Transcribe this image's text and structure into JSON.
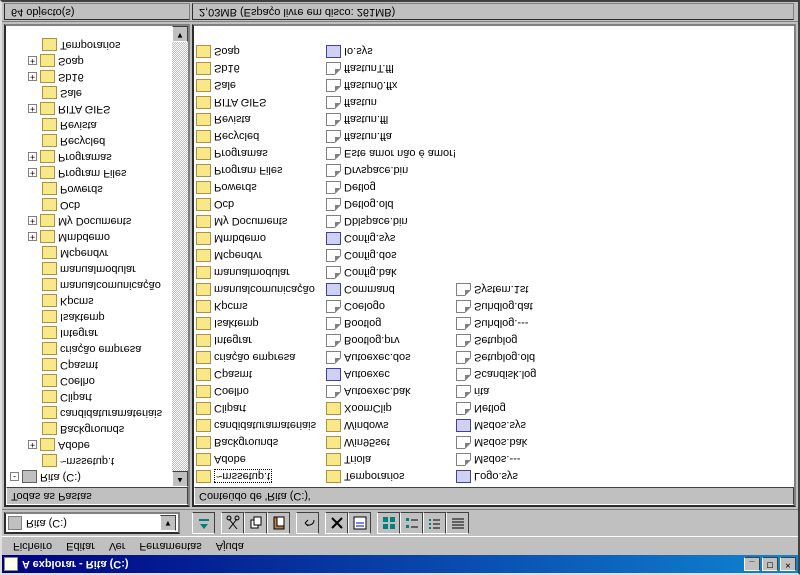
{
  "window": {
    "title": "A explorar - Rita (C:)"
  },
  "menu": {
    "file": "Ficheiro",
    "edit": "Editar",
    "view": "Ver",
    "tools": "Ferramentas",
    "help": "Ajuda"
  },
  "combo": {
    "text": "Rita (C:)"
  },
  "left_header": "Todas as Pastas",
  "right_header": "Conteúdo de 'Rita (C:)'",
  "tree": [
    {
      "indent": 0,
      "exp": "-",
      "icon": "drive",
      "label": "Rita (C:)",
      "sel": false
    },
    {
      "indent": 1,
      "exp": "",
      "label": "~mssetup.t"
    },
    {
      "indent": 1,
      "exp": "+",
      "label": "Adobe"
    },
    {
      "indent": 1,
      "exp": "",
      "label": "Backgrounds"
    },
    {
      "indent": 1,
      "exp": "",
      "label": "candidaturamateriais"
    },
    {
      "indent": 1,
      "exp": "",
      "label": "Clipart"
    },
    {
      "indent": 1,
      "exp": "",
      "label": "Coelho"
    },
    {
      "indent": 1,
      "exp": "",
      "label": "Cpasmt"
    },
    {
      "indent": 1,
      "exp": "",
      "label": "criação empresa"
    },
    {
      "indent": 1,
      "exp": "",
      "label": "Integrar"
    },
    {
      "indent": 1,
      "exp": "",
      "label": "Isaktemp"
    },
    {
      "indent": 1,
      "exp": "",
      "label": "Kpcms"
    },
    {
      "indent": 1,
      "exp": "",
      "label": "manualcomunicação"
    },
    {
      "indent": 1,
      "exp": "",
      "label": "manualmodular"
    },
    {
      "indent": 1,
      "exp": "",
      "label": "Mcpendvr"
    },
    {
      "indent": 1,
      "exp": "+",
      "label": "Mmbdemo"
    },
    {
      "indent": 1,
      "exp": "+",
      "label": "My Documents"
    },
    {
      "indent": 1,
      "exp": "",
      "label": "Ocb"
    },
    {
      "indent": 1,
      "exp": "",
      "label": "Powerds"
    },
    {
      "indent": 1,
      "exp": "+",
      "label": "Program Files"
    },
    {
      "indent": 1,
      "exp": "+",
      "label": "Programas"
    },
    {
      "indent": 1,
      "exp": "",
      "label": "Recycled"
    },
    {
      "indent": 1,
      "exp": "",
      "label": "Revista"
    },
    {
      "indent": 1,
      "exp": "+",
      "label": "RITA GIFS"
    },
    {
      "indent": 1,
      "exp": "",
      "label": "Sale"
    },
    {
      "indent": 1,
      "exp": "+",
      "label": "Sb16"
    },
    {
      "indent": 1,
      "exp": "+",
      "label": "Soap"
    },
    {
      "indent": 1,
      "exp": "",
      "label": "Temporarios"
    }
  ],
  "files": [
    {
      "t": "folder",
      "n": "~mssetup.t",
      "sel": true
    },
    {
      "t": "folder",
      "n": "Adobe"
    },
    {
      "t": "folder",
      "n": "Backgrounds"
    },
    {
      "t": "folder",
      "n": "candidaturamateriais"
    },
    {
      "t": "folder",
      "n": "Clipart"
    },
    {
      "t": "folder",
      "n": "Coelho"
    },
    {
      "t": "folder",
      "n": "Cpasmt"
    },
    {
      "t": "folder",
      "n": "criação empresa"
    },
    {
      "t": "folder",
      "n": "Integrar"
    },
    {
      "t": "folder",
      "n": "Isaktemp"
    },
    {
      "t": "folder",
      "n": "Kpcms"
    },
    {
      "t": "folder",
      "n": "manualcomunicação"
    },
    {
      "t": "folder",
      "n": "manualmodular"
    },
    {
      "t": "folder",
      "n": "Mcpendvr"
    },
    {
      "t": "folder",
      "n": "Mmbdemo"
    },
    {
      "t": "folder",
      "n": "My Documents"
    },
    {
      "t": "folder",
      "n": "Ocb"
    },
    {
      "t": "folder",
      "n": "Powerds"
    },
    {
      "t": "folder",
      "n": "Program Files"
    },
    {
      "t": "folder",
      "n": "Programas"
    },
    {
      "t": "folder",
      "n": "Recycled"
    },
    {
      "t": "folder",
      "n": "Revista"
    },
    {
      "t": "folder",
      "n": "RITA GIFS"
    },
    {
      "t": "folder",
      "n": "Sale"
    },
    {
      "t": "folder",
      "n": "Sb16"
    },
    {
      "t": "folder",
      "n": "Soap"
    },
    {
      "t": "folder",
      "n": "Temporarios"
    },
    {
      "t": "folder",
      "n": "Triola"
    },
    {
      "t": "folder",
      "n": "Win95set"
    },
    {
      "t": "folder",
      "n": "Windows"
    },
    {
      "t": "folder",
      "n": "XoomClip"
    },
    {
      "t": "file",
      "n": "Autoexec.bak"
    },
    {
      "t": "sys",
      "n": "Autoexec"
    },
    {
      "t": "file",
      "n": "Autoexec.dos"
    },
    {
      "t": "file",
      "n": "Bootlog.prv"
    },
    {
      "t": "file",
      "n": "Bootlog"
    },
    {
      "t": "file",
      "n": "Coelogo"
    },
    {
      "t": "sys",
      "n": "Command"
    },
    {
      "t": "file",
      "n": "Config.bak"
    },
    {
      "t": "file",
      "n": "Config.dos"
    },
    {
      "t": "sys",
      "n": "Config.sys"
    },
    {
      "t": "file",
      "n": "Dblspace.bin"
    },
    {
      "t": "file",
      "n": "Detlog.old"
    },
    {
      "t": "file",
      "n": "Detlog"
    },
    {
      "t": "file",
      "n": "Drvspace.bin"
    },
    {
      "t": "file",
      "n": "Este amor não é amor!"
    },
    {
      "t": "file",
      "n": "ffastun.ffa"
    },
    {
      "t": "file",
      "n": "ffastun.ffl"
    },
    {
      "t": "file",
      "n": "ffastun"
    },
    {
      "t": "file",
      "n": "ffastun0.ffx"
    },
    {
      "t": "file",
      "n": "ffastunT.ffl"
    },
    {
      "t": "sys",
      "n": "Io.sys"
    },
    {
      "t": "sys",
      "n": "Logo.sys"
    },
    {
      "t": "file",
      "n": "Msdos.---"
    },
    {
      "t": "file",
      "n": "Msdos.bak"
    },
    {
      "t": "sys",
      "n": "Msdos.sys"
    },
    {
      "t": "file",
      "n": "Netlog"
    },
    {
      "t": "file",
      "n": "rita"
    },
    {
      "t": "file",
      "n": "Scandisk.log"
    },
    {
      "t": "file",
      "n": "Setuplog.old"
    },
    {
      "t": "file",
      "n": "Setuplog"
    },
    {
      "t": "file",
      "n": "Suhdlog.---"
    },
    {
      "t": "file",
      "n": "Suhdlog.dat"
    },
    {
      "t": "file",
      "n": "System.1st"
    }
  ],
  "status": {
    "count": "64 objecto(s)",
    "summary": "2,03MB (Espaço livre em disco: 261MB)"
  }
}
